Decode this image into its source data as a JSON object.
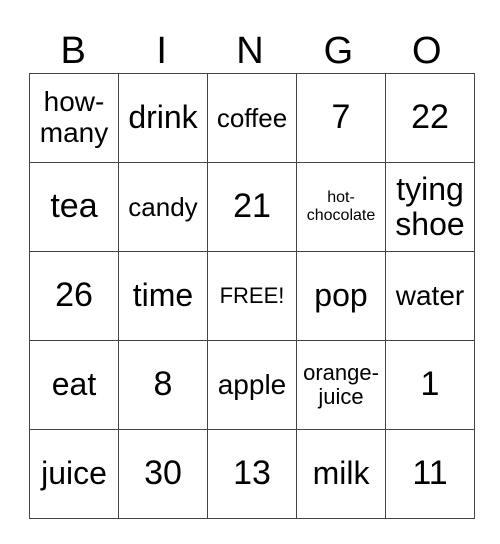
{
  "header": [
    "B",
    "I",
    "N",
    "G",
    "O"
  ],
  "rows": [
    [
      "how-\nmany",
      "drink",
      "coffee",
      "7",
      "22"
    ],
    [
      "tea",
      "candy",
      "21",
      "hot-\nchocolate",
      "tying\nshoe"
    ],
    [
      "26",
      "time",
      "FREE!",
      "pop",
      "water"
    ],
    [
      "eat",
      "8",
      "apple",
      "orange-\njuice",
      "1"
    ],
    [
      "juice",
      "30",
      "13",
      "milk",
      "11"
    ]
  ]
}
